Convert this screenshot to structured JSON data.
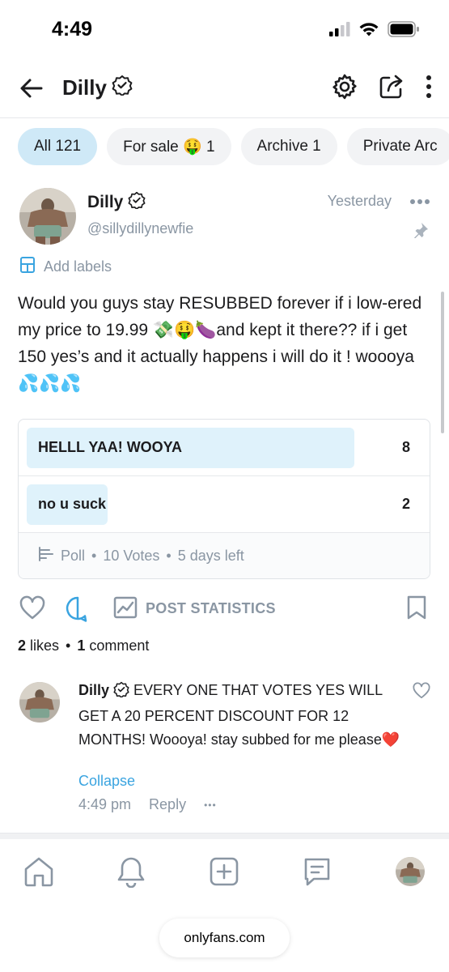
{
  "status_bar": {
    "time": "4:49"
  },
  "nav": {
    "title": "Dilly"
  },
  "tabs": [
    {
      "label": "All 121"
    },
    {
      "label": "For sale 🤑 1"
    },
    {
      "label": "Archive 1"
    },
    {
      "label": "Private Arc"
    }
  ],
  "post": {
    "author": "Dilly",
    "handle": "@sillydillynewfie",
    "time": "Yesterday",
    "add_labels": "Add labels",
    "text": "Would you guys stay RESUBBED forever if i low-ered my price to 19.99 💸🤑🍆and kept it there?? if i get 150 yes’s and it actually happens i will do it ! woooya💦💦💦"
  },
  "poll": {
    "options": [
      {
        "label": "HELLL YAA! WOOYA",
        "votes": "8",
        "fill_fraction": 0.8
      },
      {
        "label": "no u suck",
        "votes": "2",
        "fill_fraction": 0.2
      }
    ],
    "footer_type": "Poll",
    "footer_votes": "10 Votes",
    "footer_time": "5 days left"
  },
  "actions": {
    "post_statistics": "POST STATISTICS"
  },
  "counts": {
    "likes_num": "2",
    "likes_label": "likes",
    "comments_num": "1",
    "comments_label": "comment"
  },
  "comment": {
    "author": "Dilly",
    "text": "EVERY ONE THAT VOTES YES WILL GET A 20 PERCENT DISCOUNT FOR 12 MONTHS! Woooya! stay subbed for me please❤️",
    "collapse": "Collapse",
    "time": "4:49 pm",
    "reply": "Reply",
    "more": "•••"
  },
  "browser": {
    "url": "onlyfans.com"
  },
  "colors": {
    "accent": "#3aa4e0",
    "muted": "#8a96a3",
    "active_tab": "#cfe9f7",
    "poll_fill": "#dff2fb"
  }
}
